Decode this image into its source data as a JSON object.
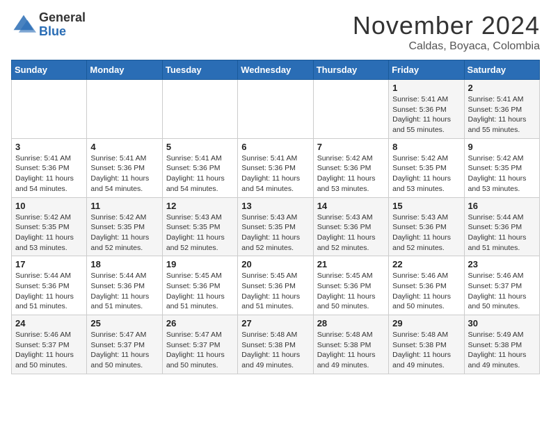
{
  "header": {
    "logo_general": "General",
    "logo_blue": "Blue",
    "month_title": "November 2024",
    "subtitle": "Caldas, Boyaca, Colombia"
  },
  "weekdays": [
    "Sunday",
    "Monday",
    "Tuesday",
    "Wednesday",
    "Thursday",
    "Friday",
    "Saturday"
  ],
  "weeks": [
    [
      {
        "day": "",
        "info": ""
      },
      {
        "day": "",
        "info": ""
      },
      {
        "day": "",
        "info": ""
      },
      {
        "day": "",
        "info": ""
      },
      {
        "day": "",
        "info": ""
      },
      {
        "day": "1",
        "info": "Sunrise: 5:41 AM\nSunset: 5:36 PM\nDaylight: 11 hours and 55 minutes."
      },
      {
        "day": "2",
        "info": "Sunrise: 5:41 AM\nSunset: 5:36 PM\nDaylight: 11 hours and 55 minutes."
      }
    ],
    [
      {
        "day": "3",
        "info": "Sunrise: 5:41 AM\nSunset: 5:36 PM\nDaylight: 11 hours and 54 minutes."
      },
      {
        "day": "4",
        "info": "Sunrise: 5:41 AM\nSunset: 5:36 PM\nDaylight: 11 hours and 54 minutes."
      },
      {
        "day": "5",
        "info": "Sunrise: 5:41 AM\nSunset: 5:36 PM\nDaylight: 11 hours and 54 minutes."
      },
      {
        "day": "6",
        "info": "Sunrise: 5:41 AM\nSunset: 5:36 PM\nDaylight: 11 hours and 54 minutes."
      },
      {
        "day": "7",
        "info": "Sunrise: 5:42 AM\nSunset: 5:36 PM\nDaylight: 11 hours and 53 minutes."
      },
      {
        "day": "8",
        "info": "Sunrise: 5:42 AM\nSunset: 5:35 PM\nDaylight: 11 hours and 53 minutes."
      },
      {
        "day": "9",
        "info": "Sunrise: 5:42 AM\nSunset: 5:35 PM\nDaylight: 11 hours and 53 minutes."
      }
    ],
    [
      {
        "day": "10",
        "info": "Sunrise: 5:42 AM\nSunset: 5:35 PM\nDaylight: 11 hours and 53 minutes."
      },
      {
        "day": "11",
        "info": "Sunrise: 5:42 AM\nSunset: 5:35 PM\nDaylight: 11 hours and 52 minutes."
      },
      {
        "day": "12",
        "info": "Sunrise: 5:43 AM\nSunset: 5:35 PM\nDaylight: 11 hours and 52 minutes."
      },
      {
        "day": "13",
        "info": "Sunrise: 5:43 AM\nSunset: 5:35 PM\nDaylight: 11 hours and 52 minutes."
      },
      {
        "day": "14",
        "info": "Sunrise: 5:43 AM\nSunset: 5:36 PM\nDaylight: 11 hours and 52 minutes."
      },
      {
        "day": "15",
        "info": "Sunrise: 5:43 AM\nSunset: 5:36 PM\nDaylight: 11 hours and 52 minutes."
      },
      {
        "day": "16",
        "info": "Sunrise: 5:44 AM\nSunset: 5:36 PM\nDaylight: 11 hours and 51 minutes."
      }
    ],
    [
      {
        "day": "17",
        "info": "Sunrise: 5:44 AM\nSunset: 5:36 PM\nDaylight: 11 hours and 51 minutes."
      },
      {
        "day": "18",
        "info": "Sunrise: 5:44 AM\nSunset: 5:36 PM\nDaylight: 11 hours and 51 minutes."
      },
      {
        "day": "19",
        "info": "Sunrise: 5:45 AM\nSunset: 5:36 PM\nDaylight: 11 hours and 51 minutes."
      },
      {
        "day": "20",
        "info": "Sunrise: 5:45 AM\nSunset: 5:36 PM\nDaylight: 11 hours and 51 minutes."
      },
      {
        "day": "21",
        "info": "Sunrise: 5:45 AM\nSunset: 5:36 PM\nDaylight: 11 hours and 50 minutes."
      },
      {
        "day": "22",
        "info": "Sunrise: 5:46 AM\nSunset: 5:36 PM\nDaylight: 11 hours and 50 minutes."
      },
      {
        "day": "23",
        "info": "Sunrise: 5:46 AM\nSunset: 5:37 PM\nDaylight: 11 hours and 50 minutes."
      }
    ],
    [
      {
        "day": "24",
        "info": "Sunrise: 5:46 AM\nSunset: 5:37 PM\nDaylight: 11 hours and 50 minutes."
      },
      {
        "day": "25",
        "info": "Sunrise: 5:47 AM\nSunset: 5:37 PM\nDaylight: 11 hours and 50 minutes."
      },
      {
        "day": "26",
        "info": "Sunrise: 5:47 AM\nSunset: 5:37 PM\nDaylight: 11 hours and 50 minutes."
      },
      {
        "day": "27",
        "info": "Sunrise: 5:48 AM\nSunset: 5:38 PM\nDaylight: 11 hours and 49 minutes."
      },
      {
        "day": "28",
        "info": "Sunrise: 5:48 AM\nSunset: 5:38 PM\nDaylight: 11 hours and 49 minutes."
      },
      {
        "day": "29",
        "info": "Sunrise: 5:48 AM\nSunset: 5:38 PM\nDaylight: 11 hours and 49 minutes."
      },
      {
        "day": "30",
        "info": "Sunrise: 5:49 AM\nSunset: 5:38 PM\nDaylight: 11 hours and 49 minutes."
      }
    ]
  ]
}
